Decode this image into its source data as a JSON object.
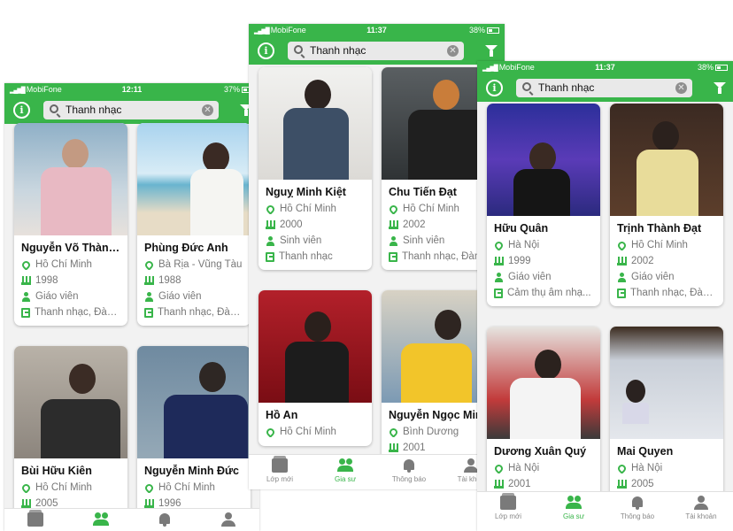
{
  "colors": {
    "brand": "#39b54a",
    "card_bg": "#ffffff",
    "muted_text": "#777777"
  },
  "icons": {
    "location": "map-pin-icon",
    "birth_year": "birthday-cake-icon",
    "occupation": "person-icon",
    "subject": "book-icon",
    "info": "info-icon",
    "filter": "filter-icon",
    "search": "search-icon",
    "clear": "clear-icon"
  },
  "phones": {
    "left": {
      "status": {
        "carrier": "MobiFone",
        "time": "12:11",
        "battery": "37%"
      },
      "search": {
        "query": "Thanh nhạc"
      },
      "cards": [
        {
          "name": "Nguyễn Võ Thành...",
          "location": "Hồ Chí Minh",
          "year": "1998",
          "occupation": "Giáo viên",
          "subject": "Thanh nhạc, Đàn..."
        },
        {
          "name": "Phùng Đức Anh",
          "location": "Bà Rịa - Vũng Tàu",
          "year": "1988",
          "occupation": "Giáo viên",
          "subject": "Thanh nhạc, Đàn..."
        },
        {
          "name": "Bùi Hữu Kiên",
          "location": "Hồ Chí Minh",
          "year": "2005",
          "occupation": "",
          "subject": ""
        },
        {
          "name": "Nguyễn Minh Đức",
          "location": "Hồ Chí Minh",
          "year": "1996",
          "occupation": "",
          "subject": ""
        }
      ],
      "tabs": [
        {
          "label": ""
        },
        {
          "label": ""
        },
        {
          "label": ""
        },
        {
          "label": ""
        }
      ]
    },
    "mid": {
      "status": {
        "carrier": "MobiFone",
        "time": "11:37",
        "battery": "38%"
      },
      "search": {
        "query": "Thanh nhạc"
      },
      "cards": [
        {
          "name": "Nguỵ Minh Kiệt",
          "location": "Hồ Chí Minh",
          "year": "2000",
          "occupation": "Sinh viên",
          "subject": "Thanh nhạc"
        },
        {
          "name": "Chu Tiến Đạt",
          "location": "Hồ Chí Minh",
          "year": "2002",
          "occupation": "Sinh viên",
          "subject": "Thanh nhạc, Đàn"
        },
        {
          "name": "Hồ An",
          "location": "Hồ Chí Minh",
          "year": "",
          "occupation": "",
          "subject": ""
        },
        {
          "name": "Nguyễn Ngọc Min",
          "location": "Bình Dương",
          "year": "2001",
          "occupation": "",
          "subject": ""
        }
      ],
      "tabs": [
        {
          "label": "Lớp mới"
        },
        {
          "label": "Gia sư"
        },
        {
          "label": "Thông báo"
        },
        {
          "label": "Tài khoả"
        }
      ]
    },
    "right": {
      "status": {
        "carrier": "MobiFone",
        "time": "11:37",
        "battery": "38%"
      },
      "search": {
        "query": "Thanh nhạc"
      },
      "cards": [
        {
          "name": "Hữu Quân",
          "location": "Hà Nội",
          "year": "1999",
          "occupation": "Giáo viên",
          "subject": "Cảm thụ âm nhạ..."
        },
        {
          "name": "Trịnh Thành Đạt",
          "location": "Hồ Chí Minh",
          "year": "2002",
          "occupation": "Giáo viên",
          "subject": "Thanh nhạc, Đàn..."
        },
        {
          "name": "Dương Xuân Quý",
          "location": "Hà Nội",
          "year": "2001",
          "occupation": "",
          "subject": ""
        },
        {
          "name": "Mai Quyen",
          "location": "Hà Nội",
          "year": "2005",
          "occupation": "",
          "subject": ""
        }
      ],
      "tabs": [
        {
          "label": "Lớp mới"
        },
        {
          "label": "Gia sư"
        },
        {
          "label": "Thông báo"
        },
        {
          "label": "Tài khoản"
        }
      ]
    }
  }
}
